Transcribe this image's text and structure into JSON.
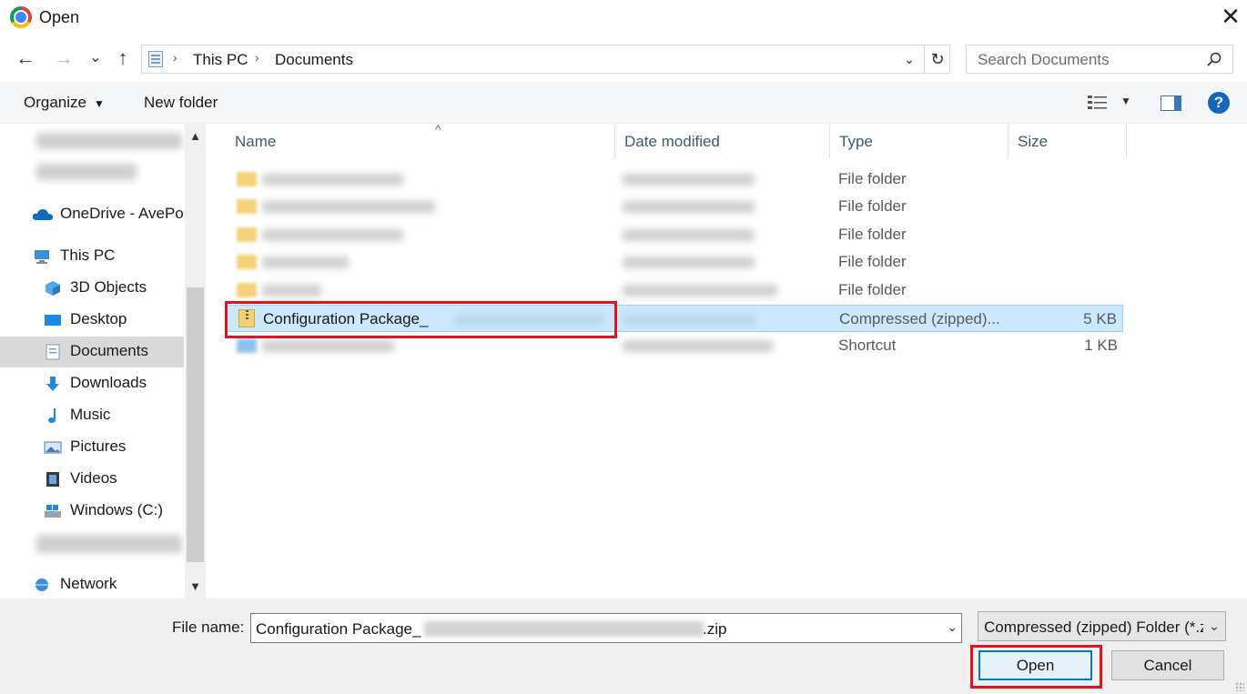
{
  "window": {
    "title": "Open",
    "close_glyph": "✕"
  },
  "nav": {
    "back_glyph": "←",
    "forward_glyph": "→",
    "recent_glyph": "⌄",
    "up_glyph": "↑",
    "breadcrumb": [
      "This PC",
      "Documents"
    ],
    "crumb_sep": "›",
    "dropdown_glyph": "⌄",
    "refresh_glyph": "↻",
    "search_placeholder": "Search Documents"
  },
  "toolbar": {
    "organize_label": "Organize",
    "organize_caret": "▼",
    "new_folder_label": "New folder",
    "view_caret": "▼",
    "help_glyph": "?"
  },
  "sidebar": {
    "scroll_up": "▲",
    "scroll_down": "▼",
    "items": [
      {
        "label": "OneDrive - AvePo",
        "icon": "onedrive-cloud-icon"
      },
      {
        "label": "This PC",
        "icon": "this-pc-icon"
      },
      {
        "label": "3D Objects",
        "icon": "3d-objects-icon"
      },
      {
        "label": "Desktop",
        "icon": "desktop-icon"
      },
      {
        "label": "Documents",
        "icon": "documents-icon",
        "selected": true
      },
      {
        "label": "Downloads",
        "icon": "downloads-icon"
      },
      {
        "label": "Music",
        "icon": "music-icon"
      },
      {
        "label": "Pictures",
        "icon": "pictures-icon"
      },
      {
        "label": "Videos",
        "icon": "videos-icon"
      },
      {
        "label": "Windows (C:)",
        "icon": "drive-icon"
      },
      {
        "label": "Network",
        "icon": "network-icon"
      }
    ]
  },
  "columns": {
    "name": "Name",
    "date_modified": "Date modified",
    "type": "Type",
    "size": "Size",
    "sort_glyph": "^"
  },
  "files": [
    {
      "name": "",
      "type": "File folder",
      "size": ""
    },
    {
      "name": "",
      "type": "File folder",
      "size": ""
    },
    {
      "name": "",
      "type": "File folder",
      "size": ""
    },
    {
      "name": "",
      "type": "File folder",
      "size": ""
    },
    {
      "name": "",
      "type": "File folder",
      "size": ""
    },
    {
      "name": "Configuration Package_",
      "type": "Compressed (zipped)...",
      "size": "5 KB",
      "selected": true
    },
    {
      "name": "",
      "type": "Shortcut",
      "size": "1 KB"
    }
  ],
  "footer": {
    "file_name_label": "File name:",
    "file_name_prefix": "Configuration Package_",
    "file_name_suffix": ".zip",
    "file_name_drop": "⌄",
    "file_type_value": "Compressed (zipped) Folder (*.zip)",
    "file_type_drop": "⌄",
    "open_label": "Open",
    "cancel_label": "Cancel"
  },
  "colors": {
    "highlight_box": "#e0131f",
    "selection": "#cce8ff",
    "accent": "#0078d7"
  }
}
